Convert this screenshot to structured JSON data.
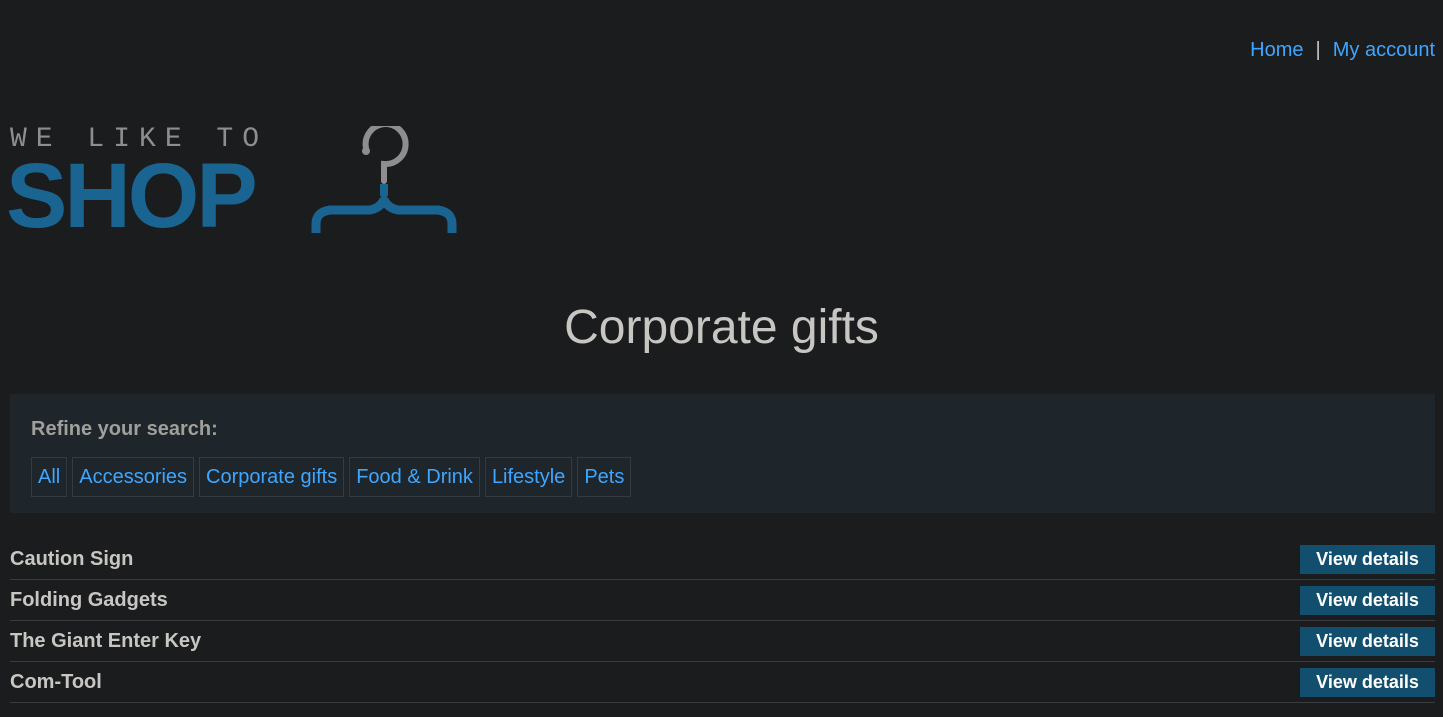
{
  "nav": {
    "home_label": "Home",
    "separator": "|",
    "account_label": "My account"
  },
  "logo": {
    "top_text": "WE LIKE TO",
    "main_text": "SHOP",
    "icon": "hanger-icon"
  },
  "page": {
    "title": "Corporate gifts"
  },
  "refine": {
    "label": "Refine your search:",
    "filters": [
      "All",
      "Accessories",
      "Corporate gifts",
      "Food & Drink",
      "Lifestyle",
      "Pets"
    ]
  },
  "products": [
    {
      "name": "Caution Sign",
      "button": "View details"
    },
    {
      "name": "Folding Gadgets",
      "button": "View details"
    },
    {
      "name": "The Giant Enter Key",
      "button": "View details"
    },
    {
      "name": "Com-Tool",
      "button": "View details"
    }
  ],
  "colors": {
    "background": "#1b1c1e",
    "link": "#3ea6ff",
    "logo_blue": "#1a6492",
    "button": "#124f6e",
    "panel": "#1e262c"
  }
}
